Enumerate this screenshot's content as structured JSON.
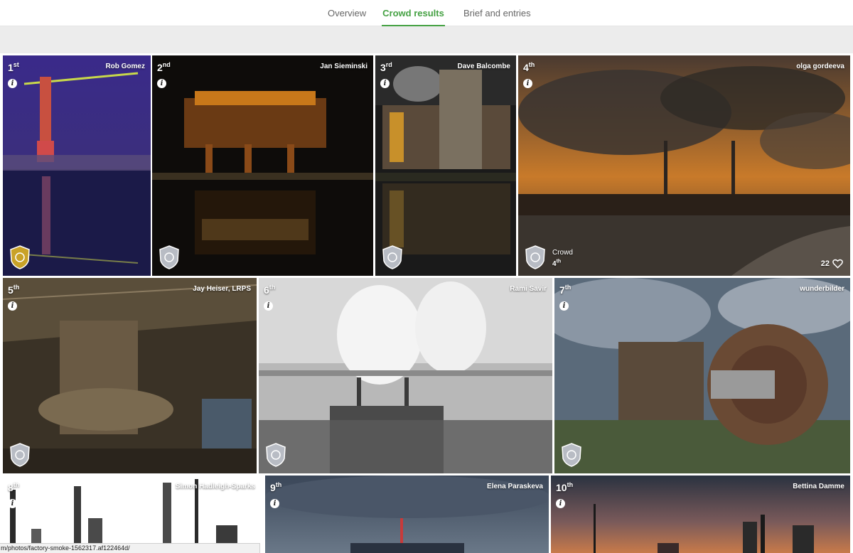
{
  "nav": {
    "tabs": [
      {
        "label": "Overview",
        "active": false
      },
      {
        "label": "Crowd results",
        "active": true
      },
      {
        "label": "Brief and entries",
        "active": false
      }
    ],
    "accent_color": "#45a143"
  },
  "entries": [
    {
      "rank_num": "1",
      "rank_suffix": "st",
      "author": "Rob Gomez",
      "badge": "gold-crowd-badge"
    },
    {
      "rank_num": "2",
      "rank_suffix": "nd",
      "author": "Jan Sieminski",
      "badge": "silver-crowd-badge"
    },
    {
      "rank_num": "3",
      "rank_suffix": "rd",
      "author": "Dave Balcombe",
      "badge": "silver-crowd-badge"
    },
    {
      "rank_num": "4",
      "rank_suffix": "th",
      "author": "olga gordeeva",
      "badge": "silver-crowd-badge",
      "crowd_label": "Crowd",
      "crowd_rank_num": "4",
      "crowd_rank_suffix": "th",
      "likes": "22"
    },
    {
      "rank_num": "5",
      "rank_suffix": "th",
      "author": "Jay Heiser, LRPS",
      "badge": "silver-crowd-badge"
    },
    {
      "rank_num": "6",
      "rank_suffix": "th",
      "author": "Rami Savir",
      "badge": "silver-crowd-badge"
    },
    {
      "rank_num": "7",
      "rank_suffix": "th",
      "author": "wunderbilder",
      "badge": "silver-crowd-badge"
    },
    {
      "rank_num": "8",
      "rank_suffix": "th",
      "author": "Simon Hadleigh-Sparks"
    },
    {
      "rank_num": "9",
      "rank_suffix": "th",
      "author": "Elena Paraskeva"
    },
    {
      "rank_num": "10",
      "rank_suffix": "th",
      "author": "Bettina Damme"
    }
  ],
  "status_url": "m/photos/factory-smoke-1562317.af122464d/",
  "icons": {
    "info": "info-icon",
    "heart": "heart-icon",
    "badge": "crowd-badge-icon"
  },
  "info_glyph": "i"
}
